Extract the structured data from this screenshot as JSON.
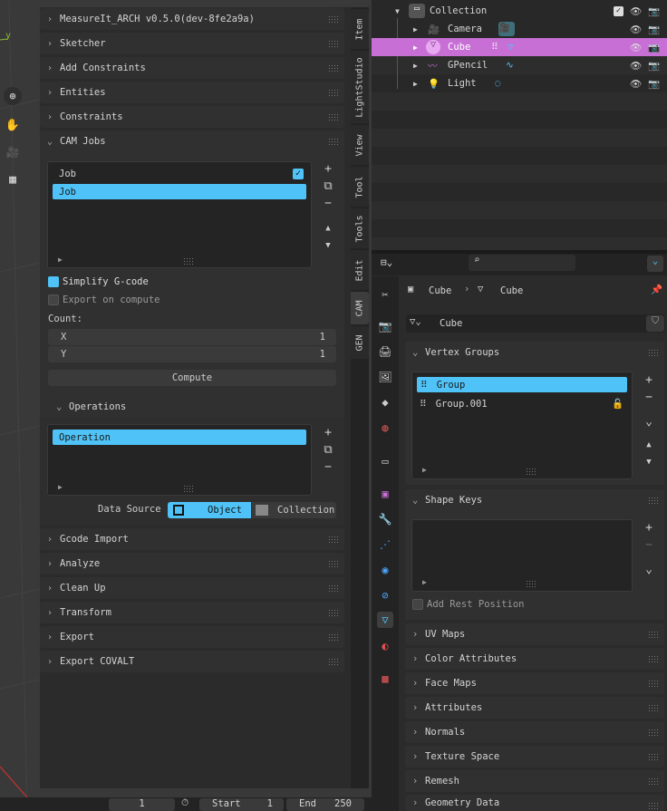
{
  "sidebar": {
    "panels_top": [
      "MeasureIt_ARCH v0.5.0(dev-8fe2a9a)",
      "Sketcher",
      "Add Constraints",
      "Entities",
      "Constraints",
      "CAM Jobs"
    ],
    "jobs": [
      "Job",
      "Job"
    ],
    "simplify_label": "Simplify G-code",
    "export_label": "Export on compute",
    "count_label": "Count:",
    "x_label": "X",
    "x_value": "1",
    "y_label": "Y",
    "y_value": "1",
    "compute_label": "Compute",
    "operations_label": "Operations",
    "operation_item": "Operation",
    "data_source_label": "Data Source",
    "data_source_object": "Object",
    "data_source_collection": "Collection",
    "panels_bottom": [
      "Gcode Import",
      "Analyze",
      "Clean Up",
      "Transform",
      "Export",
      "Export COVALT"
    ]
  },
  "tabs": [
    "Item",
    "LightStudio",
    "View",
    "Tool",
    "Tools",
    "Edit",
    "CAM",
    "GEN"
  ],
  "outliner": {
    "collection": "Collection",
    "items": [
      "Camera",
      "Cube",
      "GPencil",
      "Light"
    ]
  },
  "props": {
    "breadcrumb_a": "Cube",
    "breadcrumb_b": "Cube",
    "mesh_name": "Cube",
    "vertex_groups_label": "Vertex Groups",
    "groups": [
      "Group",
      "Group.001"
    ],
    "shape_keys_label": "Shape Keys",
    "add_rest_label": "Add Rest Position",
    "panels": [
      "UV Maps",
      "Color Attributes",
      "Face Maps",
      "Attributes",
      "Normals",
      "Texture Space",
      "Remesh",
      "Geometry Data"
    ]
  },
  "timeline": {
    "frame": "1",
    "start_label": "Start",
    "start": "1",
    "end_label": "End",
    "end": "250"
  },
  "viewport": {
    "axis_label": "y"
  },
  "colors": {
    "accent": "#4fc3f7",
    "selected_row": "#c86fd6"
  }
}
